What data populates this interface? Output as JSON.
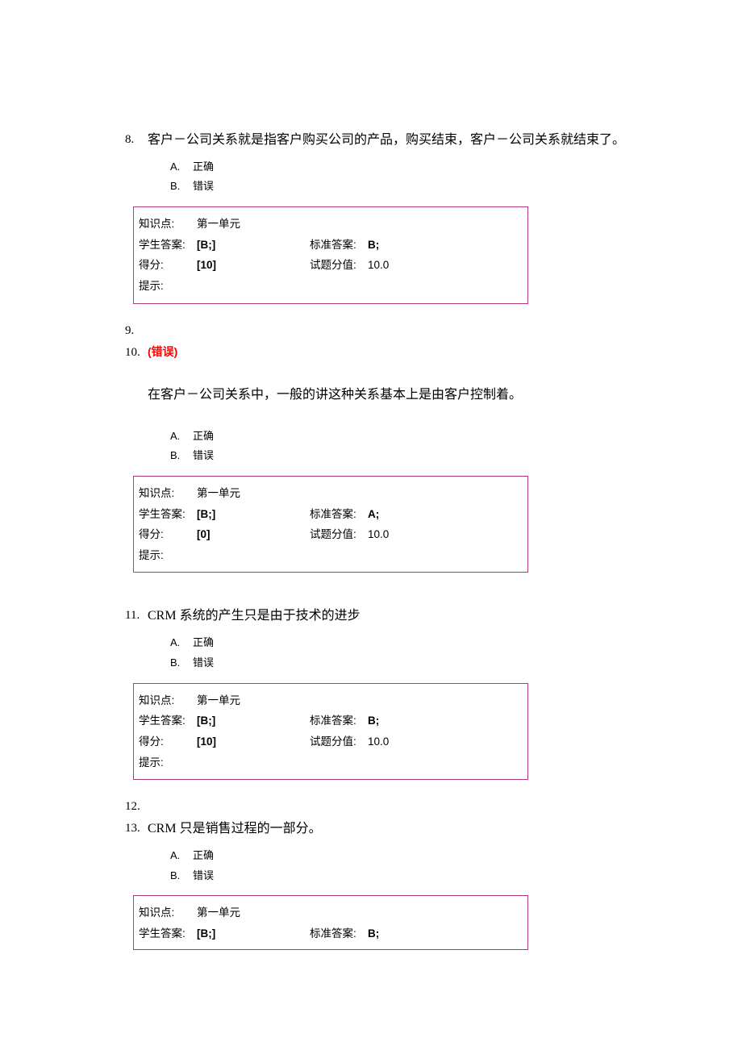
{
  "questions": [
    {
      "num": "8.",
      "text": "客户－公司关系就是指客户购买公司的产品，购买结束，客户－公司关系就结束了。",
      "optA": "正确",
      "optB": "错误",
      "topic_l": "知识点:",
      "topic_v": "第一单元",
      "sa_l": "学生答案:",
      "sa_v": "[B;]",
      "ca_l": "标准答案:",
      "ca_v": "B;",
      "sc_l": "得分:",
      "sc_v": "[10]",
      "pv_l": "试题分值:",
      "pv_v": "10.0",
      "hint_l": "提示:"
    },
    {
      "stub_before": "9.",
      "num": "10.",
      "err": "(错误)",
      "detached_text": "在客户－公司关系中，一般的讲这种关系基本上是由客户控制着。",
      "optA": "正确",
      "optB": "错误",
      "topic_l": "知识点:",
      "topic_v": "第一单元",
      "sa_l": "学生答案:",
      "sa_v": "[B;]",
      "ca_l": "标准答案:",
      "ca_v": "A;",
      "sc_l": "得分:",
      "sc_v": "[0]",
      "pv_l": "试题分值:",
      "pv_v": "10.0",
      "hint_l": "提示:"
    },
    {
      "num": "11.",
      "text": "CRM 系统的产生只是由于技术的进步",
      "optA": "正确",
      "optB": "错误",
      "topic_l": "知识点:",
      "topic_v": "第一单元",
      "sa_l": "学生答案:",
      "sa_v": "[B;]",
      "ca_l": "标准答案:",
      "ca_v": "B;",
      "sc_l": "得分:",
      "sc_v": "[10]",
      "pv_l": "试题分值:",
      "pv_v": "10.0",
      "hint_l": "提示:"
    },
    {
      "stub_before": "12.",
      "num": "13.",
      "text": "CRM 只是销售过程的一部分。",
      "optA": "正确",
      "optB": "错误",
      "topic_l": "知识点:",
      "topic_v": "第一单元",
      "sa_l": "学生答案:",
      "sa_v": "[B;]",
      "ca_l": "标准答案:",
      "ca_v": "B;",
      "partial": true
    }
  ],
  "letters": {
    "A": "A.",
    "B": "B."
  }
}
